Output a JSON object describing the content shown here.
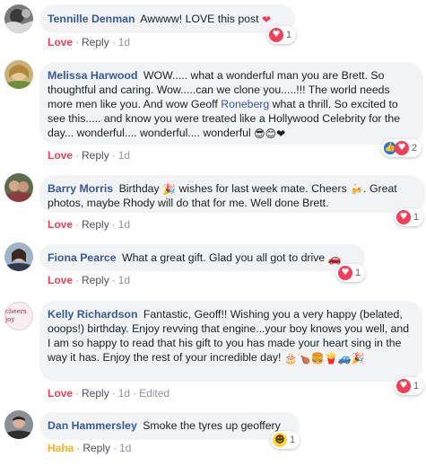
{
  "colors": {
    "author": "#385898",
    "bubble_bg": "#f2f3f5",
    "love": "#f33e58",
    "haha": "#f7b125",
    "like": "#1877f2",
    "meta": "#90949c"
  },
  "comments": [
    {
      "author": "Tennille Denman",
      "text": "Awwww! LOVE this post",
      "emoji_end": "❤",
      "reaction_label": "Love",
      "reply_label": "Reply",
      "time": "1d",
      "reaction_count": "1",
      "reaction_icons": [
        "love-icon"
      ],
      "online": true
    },
    {
      "author": "Melissa Harwood",
      "text_a": "WOW..... what a wonderful man you are Brett. So thoughtful and caring. Wow.....can we clone you.....!!! The world needs more men like you. And wow Geoff",
      "tag": "Roneberg",
      "text_b": "what a thrill. So excited to see this..... and know you were treated like a Hollywood Celebrity for the day... wonderful.... wonderful.... wonderful",
      "emoji_end": "😎😊❤",
      "reaction_label": "Love",
      "reply_label": "Reply",
      "time": "1d",
      "reaction_count": "2",
      "reaction_icons": [
        "like-icon",
        "love-icon"
      ],
      "online": false
    },
    {
      "author": "Barry Morris",
      "text_a": "Birthday",
      "emoji_mid": "🎉",
      "text_b": "wishes for last week mate. Cheers",
      "emoji_mid2": "🍻",
      "text_c": ". Great photos, maybe Rhody will do that for me. Well done Brett.",
      "reaction_label": "Love",
      "reply_label": "Reply",
      "time": "1d",
      "reaction_count": "1",
      "reaction_icons": [
        "love-icon"
      ],
      "online": false
    },
    {
      "author": "Fiona Pearce",
      "text": "What a great gift. Glad you all got to drive",
      "emoji_end": "🚗",
      "reaction_label": "Love",
      "reply_label": "Reply",
      "time": "1d",
      "reaction_count": "1",
      "reaction_icons": [
        "love-icon"
      ],
      "online": false
    },
    {
      "author": "Kelly Richardson",
      "avatar_text": "cheers joy",
      "text": "Fantastic, Geoff!! Wishing you a very happy (belated, ooops!) birthday. Enjoy revving that engine...your boy knows you well, and I am so happy to read that his gift to you has made your heart sing in the way it has. Enjoy the rest of your incredible day!",
      "emoji_end": "🎂🍗🍔🍟🚙🎉",
      "reaction_label": "Love",
      "reply_label": "Reply",
      "time": "1d",
      "edited_label": "Edited",
      "reaction_count": "1",
      "reaction_icons": [
        "love-icon"
      ],
      "online": false
    },
    {
      "author": "Dan Hammersley",
      "text": "Smoke the tyres up geoffery",
      "reaction_label": "Haha",
      "reply_label": "Reply",
      "time": "1d",
      "reaction_count": "1",
      "reaction_icons": [
        "haha-icon"
      ],
      "online": true
    }
  ]
}
